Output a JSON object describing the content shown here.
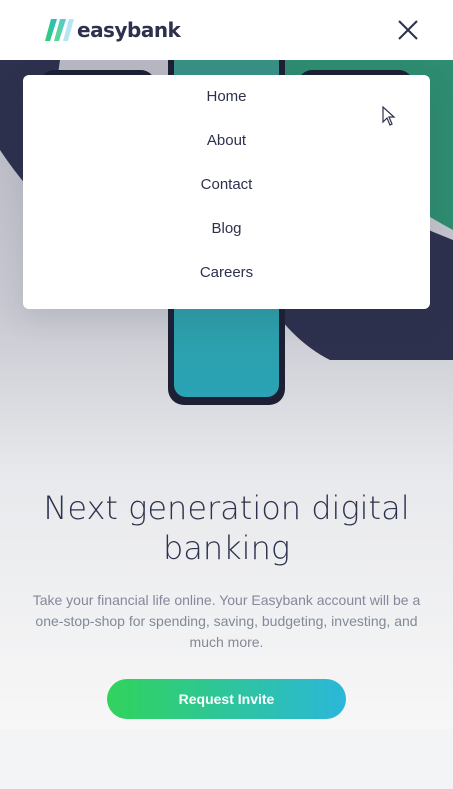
{
  "brand": {
    "name": "easybank"
  },
  "header": {
    "close_icon": "close-icon"
  },
  "menu": {
    "items": [
      {
        "label": "Home"
      },
      {
        "label": "About"
      },
      {
        "label": "Contact"
      },
      {
        "label": "Blog"
      },
      {
        "label": "Careers"
      }
    ]
  },
  "hero": {
    "title": "Next generation digital banking",
    "description": "Take your financial life online. Your Easybank account will be a one-stop-shop for spending, saving, budgeting, investing, and much more.",
    "cta_label": "Request Invite"
  },
  "colors": {
    "dark_blue": "#2d314d",
    "lime_green": "#31d35c",
    "bright_cyan": "#2bb7da",
    "grayish_blue": "#848899"
  }
}
